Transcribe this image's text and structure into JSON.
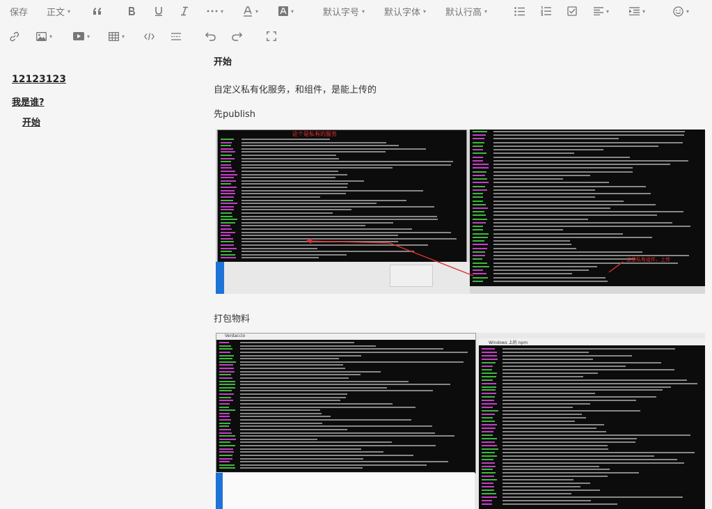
{
  "toolbar": {
    "save": "保存",
    "paragraph": "正文",
    "font_size": "默认字号",
    "font_family": "默认字体",
    "line_height": "默认行高",
    "caret": "▾"
  },
  "toc": {
    "items": [
      {
        "label": "12123123"
      },
      {
        "label": "我是谁?"
      },
      {
        "label": "开始"
      }
    ]
  },
  "doc": {
    "heading": "开始",
    "para1": "自定义私有化服务，和组件，是能上传的",
    "para2": "先publish",
    "para3": "打包物料",
    "image1": {
      "annot_top": "这个是私有的服务",
      "annot_right": "这是私有组件，上传",
      "win_title": ""
    },
    "image2": {
      "win_title_left": "Verdaccio",
      "win_title_right": "Windows 上的 npm"
    }
  },
  "colors": {
    "terminal_bg": "#0c0c0c",
    "term_green": "#3dbb3d",
    "term_text": "#bdbdbd",
    "term_magenta": "#c73fc7",
    "annot_red": "#e03030",
    "taskbar_blue": "#1e73d6"
  }
}
